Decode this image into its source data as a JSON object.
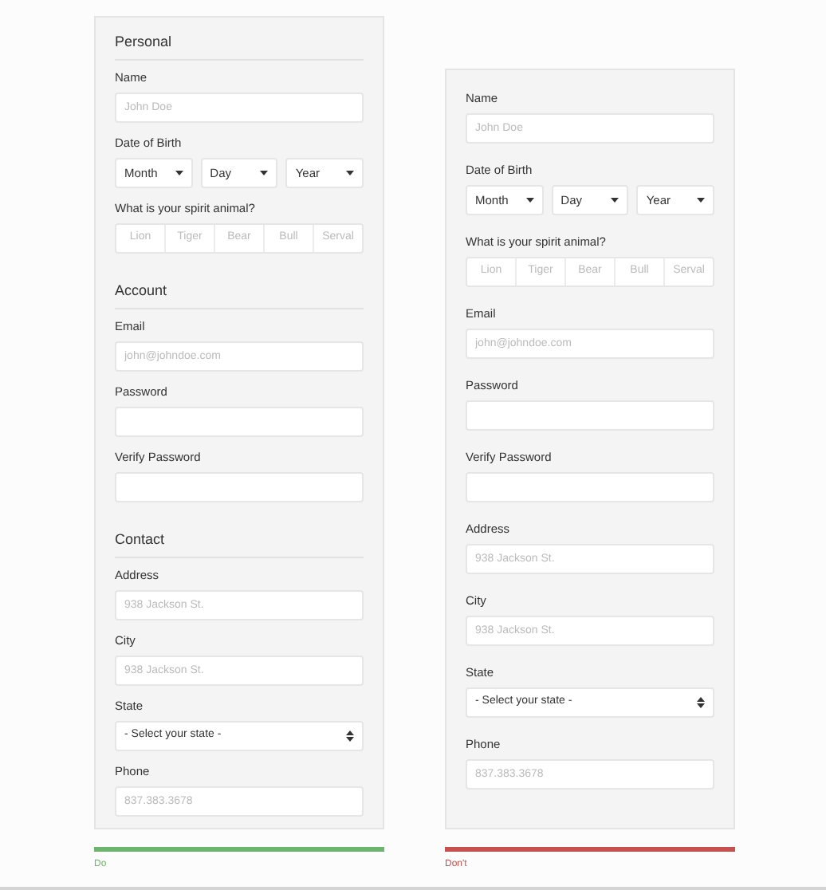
{
  "panels": [
    {
      "sections": [
        {
          "title": "Personal",
          "fields": [
            {
              "kind": "text",
              "label": "Name",
              "placeholder": "John Doe"
            },
            {
              "kind": "dropdowns",
              "label": "Date of Birth",
              "options": [
                "Month",
                "Day",
                "Year"
              ]
            },
            {
              "kind": "segmented",
              "label": "What is your spirit animal?",
              "options": [
                "Lion",
                "Tiger",
                "Bear",
                "Bull",
                "Serval"
              ]
            }
          ]
        },
        {
          "title": "Account",
          "fields": [
            {
              "kind": "text",
              "label": "Email",
              "placeholder": "john@johndoe.com"
            },
            {
              "kind": "password",
              "label": "Password"
            },
            {
              "kind": "password",
              "label": "Verify Password"
            }
          ]
        },
        {
          "title": "Contact",
          "fields": [
            {
              "kind": "text",
              "label": "Address",
              "placeholder": "938 Jackson St."
            },
            {
              "kind": "text",
              "label": "City",
              "placeholder": "938 Jackson St."
            },
            {
              "kind": "select",
              "label": "State",
              "value": "- Select your state -"
            },
            {
              "kind": "text",
              "label": "Phone",
              "placeholder": "837.383.3678"
            }
          ]
        }
      ],
      "verdict": {
        "label": "Do",
        "color": "#6db56d"
      }
    },
    {
      "sections": [
        {
          "fields": [
            {
              "kind": "text",
              "label": "Name",
              "placeholder": "John Doe"
            },
            {
              "kind": "dropdowns",
              "label": "Date of Birth",
              "options": [
                "Month",
                "Day",
                "Year"
              ]
            },
            {
              "kind": "segmented",
              "label": "What is your spirit animal?",
              "options": [
                "Lion",
                "Tiger",
                "Bear",
                "Bull",
                "Serval"
              ]
            },
            {
              "kind": "text",
              "label": "Email",
              "placeholder": "john@johndoe.com"
            },
            {
              "kind": "password",
              "label": "Password"
            },
            {
              "kind": "password",
              "label": "Verify Password"
            },
            {
              "kind": "text",
              "label": "Address",
              "placeholder": "938 Jackson St."
            },
            {
              "kind": "text",
              "label": "City",
              "placeholder": "938 Jackson St."
            },
            {
              "kind": "select",
              "label": "State",
              "value": "- Select your state -"
            },
            {
              "kind": "text",
              "label": "Phone",
              "placeholder": "837.383.3678"
            }
          ]
        }
      ],
      "verdict": {
        "label": "Don't",
        "color": "#c55251"
      }
    }
  ]
}
